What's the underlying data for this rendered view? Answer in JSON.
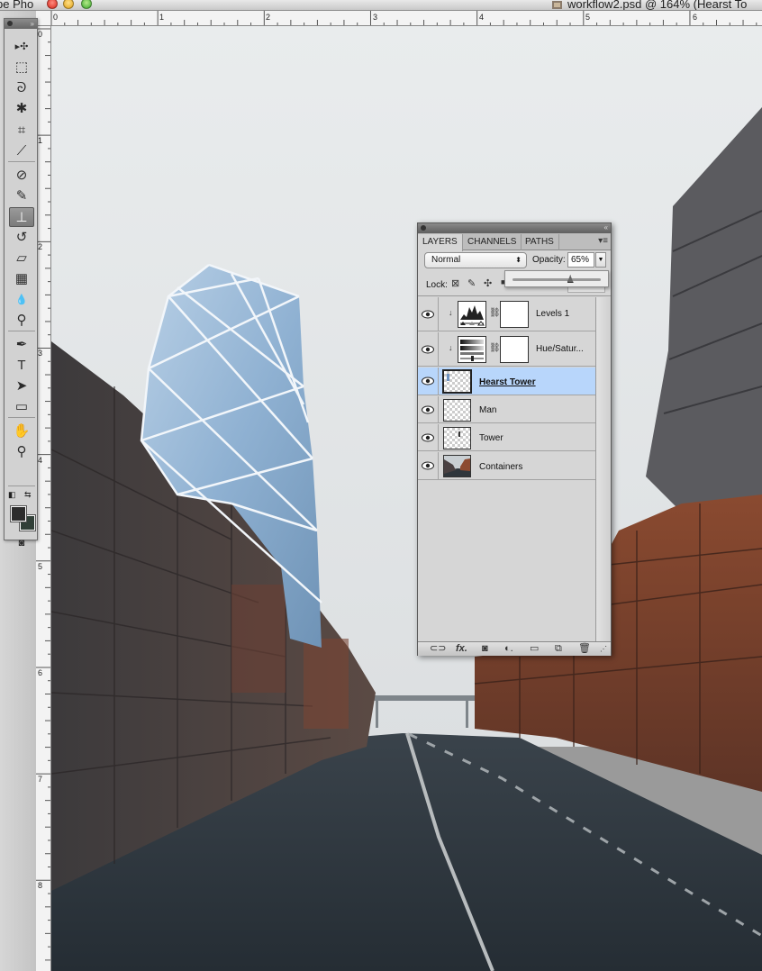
{
  "window": {
    "app_title_fragment": "be Pho",
    "doc_title": "workflow2.psd @ 164% (Hearst To"
  },
  "rulers": {
    "top": [
      "0",
      "1",
      "2",
      "3",
      "4",
      "5",
      "6"
    ],
    "left": [
      "0",
      "1",
      "2",
      "3",
      "4",
      "5",
      "6",
      "7",
      "8"
    ]
  },
  "tools": [
    {
      "name": "move-tool",
      "glyph": "▸✣"
    },
    {
      "name": "marquee-tool",
      "glyph": "⬚"
    },
    {
      "name": "lasso-tool",
      "glyph": "ᘐ"
    },
    {
      "name": "magic-wand-tool",
      "glyph": "✱"
    },
    {
      "name": "crop-tool",
      "glyph": "⌗"
    },
    {
      "name": "eyedropper-tool",
      "glyph": "⟋"
    },
    {
      "name": "healing-brush-tool",
      "glyph": "⊘"
    },
    {
      "name": "brush-tool",
      "glyph": "✎"
    },
    {
      "name": "clone-stamp-tool",
      "glyph": "⊥"
    },
    {
      "name": "history-brush-tool",
      "glyph": "↺"
    },
    {
      "name": "eraser-tool",
      "glyph": "▱"
    },
    {
      "name": "gradient-tool",
      "glyph": "▦"
    },
    {
      "name": "blur-tool",
      "glyph": "💧"
    },
    {
      "name": "dodge-tool",
      "glyph": "⚲"
    },
    {
      "name": "pen-tool",
      "glyph": "✒"
    },
    {
      "name": "type-tool",
      "glyph": "T"
    },
    {
      "name": "path-selection-tool",
      "glyph": "➤"
    },
    {
      "name": "rectangle-tool",
      "glyph": "▭"
    },
    {
      "name": "hand-tool",
      "glyph": "✋"
    },
    {
      "name": "zoom-tool",
      "glyph": "⚲"
    }
  ],
  "selected_tool": "clone-stamp-tool",
  "layers_panel": {
    "tabs": [
      "LAYERS",
      "CHANNELS",
      "PATHS"
    ],
    "active_tab": "LAYERS",
    "blend_mode": "Normal",
    "opacity_label": "Opacity:",
    "opacity_value": "65%",
    "opacity_fraction": 0.65,
    "lock_label": "Lock:",
    "layers": [
      {
        "name": "Levels 1",
        "type": "adjustment-levels",
        "visible": true,
        "selected": false,
        "clipped": true
      },
      {
        "name": "Hue/Satur...",
        "type": "adjustment-hue",
        "visible": true,
        "selected": false,
        "clipped": true
      },
      {
        "name": "Hearst Tower",
        "type": "pixel",
        "visible": true,
        "selected": true,
        "clipped": false
      },
      {
        "name": "Man",
        "type": "pixel",
        "visible": true,
        "selected": false,
        "clipped": false
      },
      {
        "name": "Tower",
        "type": "pixel",
        "visible": true,
        "selected": false,
        "clipped": false
      },
      {
        "name": "Containers",
        "type": "photo",
        "visible": true,
        "selected": false,
        "clipped": false
      }
    ],
    "footer_icons": [
      "link-icon",
      "fx-icon",
      "mask-icon",
      "adjustment-icon",
      "folder-icon",
      "new-layer-icon",
      "trash-icon"
    ]
  },
  "colors": {
    "foreground": "#2c2c2c",
    "background": "#314038",
    "selection": "#b8d6fb"
  }
}
